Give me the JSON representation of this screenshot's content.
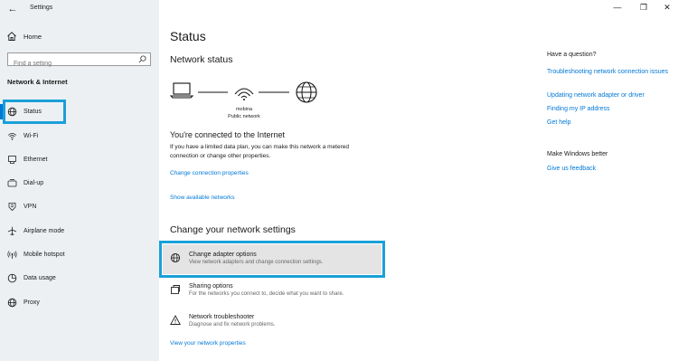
{
  "window": {
    "title": "Settings",
    "back_glyph": "←",
    "minimize_glyph": "—",
    "maximize_glyph": "❐",
    "close_glyph": "✕"
  },
  "sidebar": {
    "home_label": "Home",
    "search_placeholder": "Find a setting",
    "section_title": "Network & Internet",
    "items": [
      {
        "label": "Status",
        "icon": "globe-icon",
        "selected": true
      },
      {
        "label": "Wi-Fi",
        "icon": "wifi-icon"
      },
      {
        "label": "Ethernet",
        "icon": "ethernet-icon"
      },
      {
        "label": "Dial-up",
        "icon": "dialup-icon"
      },
      {
        "label": "VPN",
        "icon": "vpn-icon"
      },
      {
        "label": "Airplane mode",
        "icon": "airplane-icon"
      },
      {
        "label": "Mobile hotspot",
        "icon": "hotspot-icon"
      },
      {
        "label": "Data usage",
        "icon": "data-usage-icon"
      },
      {
        "label": "Proxy",
        "icon": "globe-icon"
      }
    ]
  },
  "main": {
    "page_title": "Status",
    "network_status_title": "Network status",
    "network_name": "mobina",
    "network_type": "Public network",
    "connected_title": "You're connected to the Internet",
    "connected_desc": "If you have a limited data plan, you can make this network a metered connection or change other properties.",
    "change_connection_link": "Change connection properties",
    "show_networks_link": "Show available networks",
    "change_settings_title": "Change your network settings",
    "options": [
      {
        "title": "Change adapter options",
        "desc": "View network adapters and change connection settings.",
        "icon": "adapter-icon"
      },
      {
        "title": "Sharing options",
        "desc": "For the networks you connect to, decide what you want to share.",
        "icon": "sharing-icon"
      },
      {
        "title": "Network troubleshooter",
        "desc": "Diagnose and fix network problems.",
        "icon": "warning-icon"
      }
    ],
    "view_properties_link": "View your network properties"
  },
  "right": {
    "question_title": "Have a question?",
    "links": [
      "Troubleshooting network connection issues",
      "Updating network adapter or driver",
      "Finding my IP address",
      "Get help"
    ],
    "better_title": "Make Windows better",
    "feedback_link": "Give us feedback"
  },
  "colors": {
    "accent": "#0078d7",
    "highlight_border": "#1aa0d8",
    "sidebar_bg": "#edf0f3"
  }
}
